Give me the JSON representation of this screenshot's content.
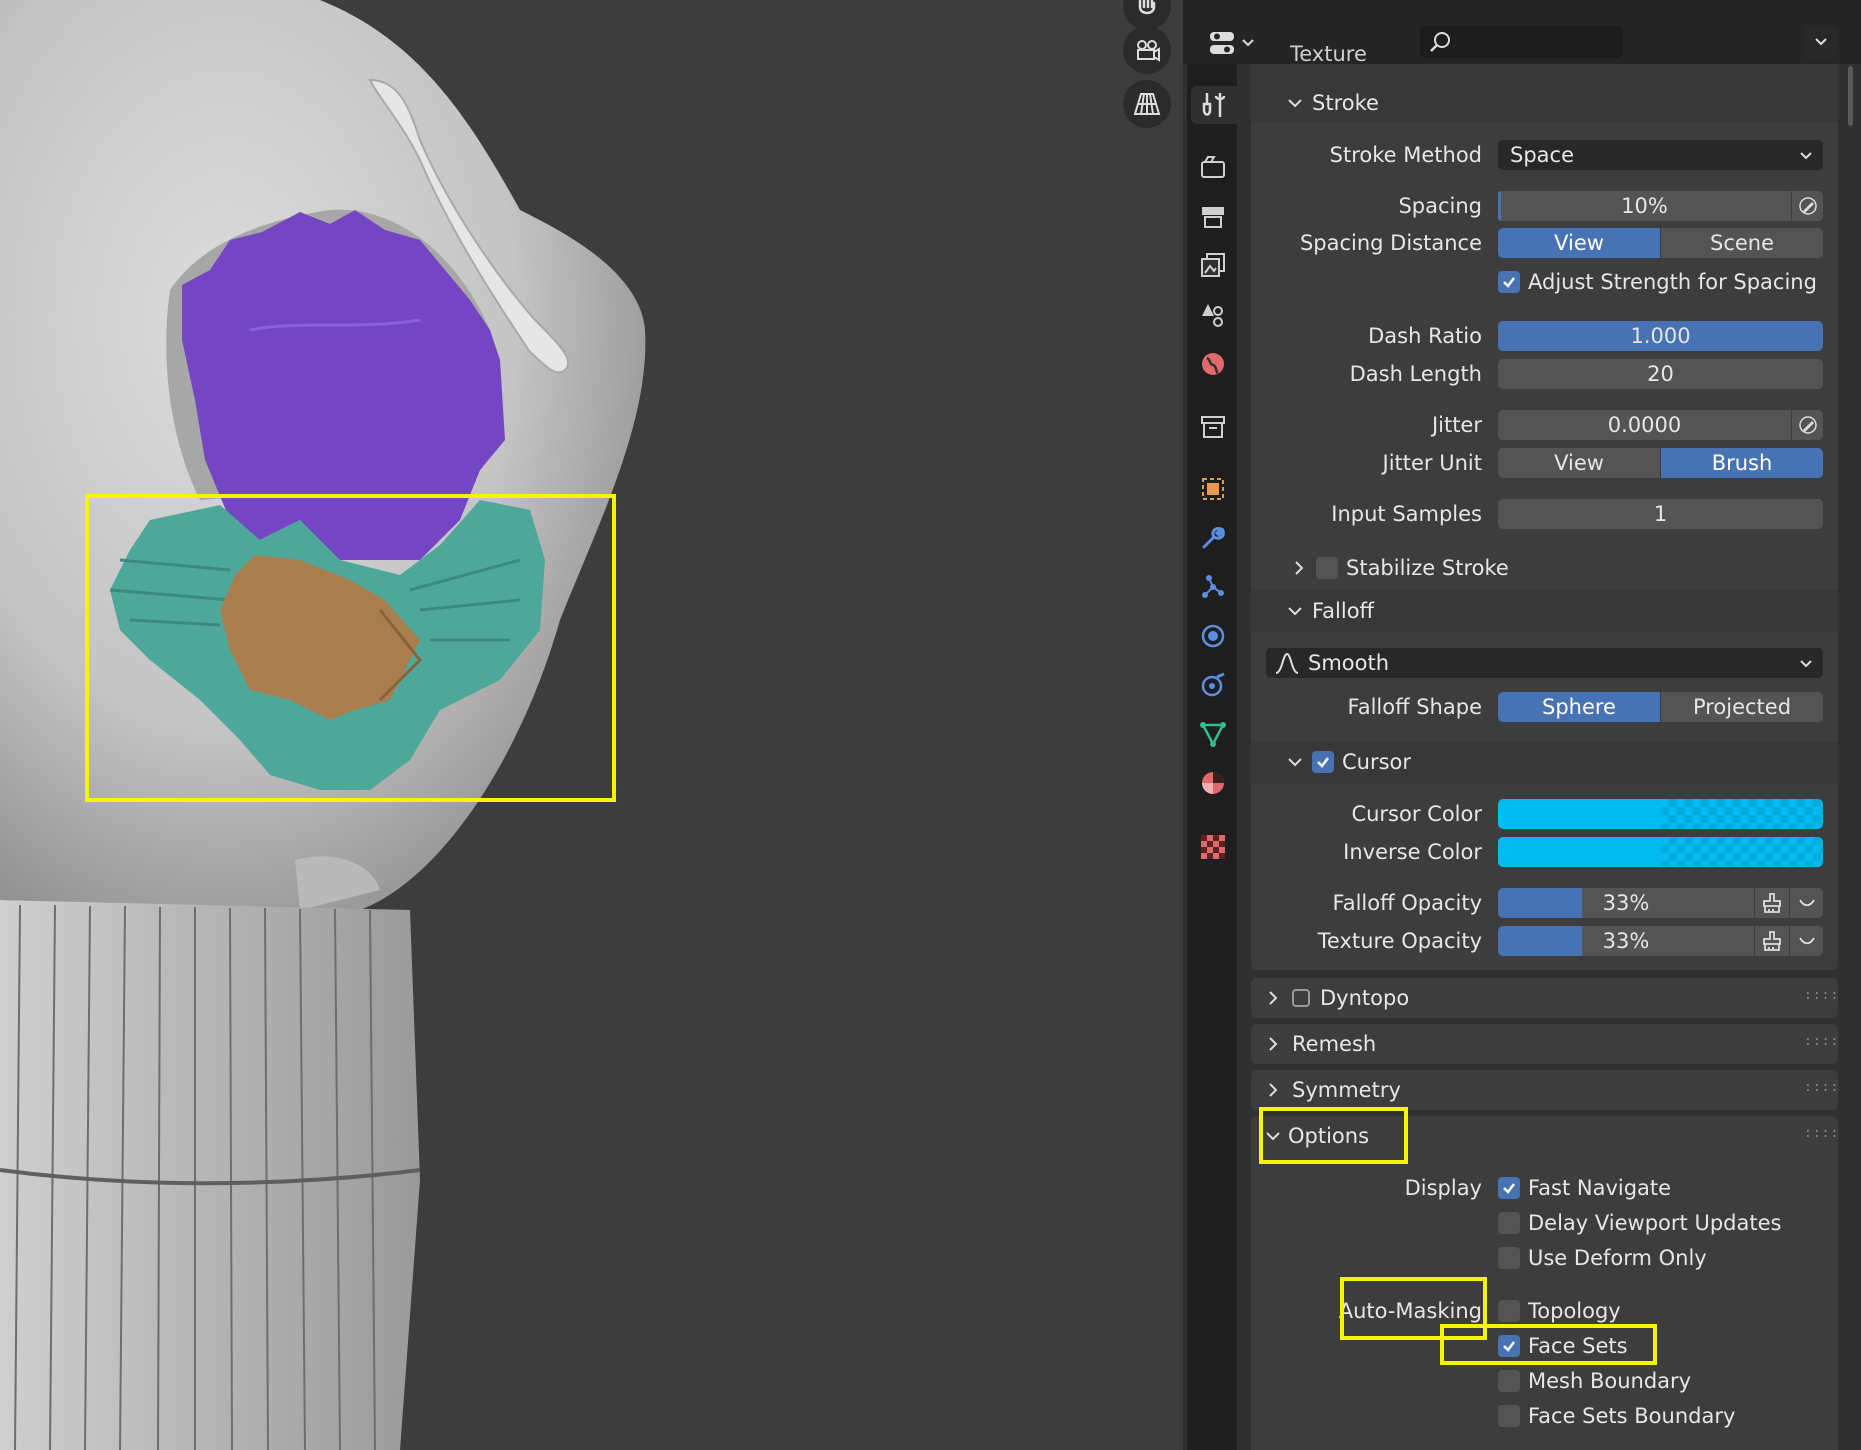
{
  "header": {
    "search_placeholder": "",
    "partial_panel": "Texture"
  },
  "tabs": [
    {
      "name": "tool-icon",
      "color": "#cfcfcf"
    },
    {
      "name": "render-icon",
      "color": "#cfcfcf"
    },
    {
      "name": "output-icon",
      "color": "#cfcfcf"
    },
    {
      "name": "view-layer-icon",
      "color": "#cfcfcf"
    },
    {
      "name": "scene-icon",
      "color": "#cfcfcf"
    },
    {
      "name": "world-icon",
      "color": "#e06a6a"
    },
    {
      "name": "collection-icon",
      "color": "#cfcfcf"
    },
    {
      "name": "object-icon",
      "color": "#e89a4c"
    },
    {
      "name": "modifier-icon",
      "color": "#5b8ee0"
    },
    {
      "name": "particles-icon",
      "color": "#5b8ee0"
    },
    {
      "name": "physics-icon",
      "color": "#5b8ee0"
    },
    {
      "name": "constraints-icon",
      "color": "#5b8ee0"
    },
    {
      "name": "data-icon",
      "color": "#2fbf8f"
    },
    {
      "name": "material-icon",
      "color": "#e06a6a"
    },
    {
      "name": "texture-icon",
      "color": "#e06a6a"
    }
  ],
  "stroke": {
    "title": "Stroke",
    "method_label": "Stroke Method",
    "method_value": "Space",
    "spacing_label": "Spacing",
    "spacing_value": "10%",
    "spacing_fill": 0.01,
    "spacing_distance_label": "Spacing Distance",
    "spacing_distance_options": [
      "View",
      "Scene"
    ],
    "adjust_strength_label": "Adjust Strength for Spacing",
    "dash_ratio_label": "Dash Ratio",
    "dash_ratio_value": "1.000",
    "dash_length_label": "Dash Length",
    "dash_length_value": "20",
    "jitter_label": "Jitter",
    "jitter_value": "0.0000",
    "jitter_unit_label": "Jitter Unit",
    "jitter_unit_options": [
      "View",
      "Brush"
    ],
    "input_samples_label": "Input Samples",
    "input_samples_value": "1",
    "stabilize_label": "Stabilize Stroke"
  },
  "falloff": {
    "title": "Falloff",
    "preset_value": "Smooth",
    "shape_label": "Falloff Shape",
    "shape_options": [
      "Sphere",
      "Projected"
    ]
  },
  "cursor": {
    "title": "Cursor",
    "cursor_color_label": "Cursor Color",
    "inverse_color_label": "Inverse Color",
    "cursor_color": "#00bbf0",
    "falloff_opacity_label": "Falloff Opacity",
    "falloff_opacity_value": "33%",
    "falloff_opacity_fill": 0.33,
    "texture_opacity_label": "Texture Opacity",
    "texture_opacity_value": "33%",
    "texture_opacity_fill": 0.33
  },
  "panels": {
    "dyntopo": "Dyntopo",
    "remesh": "Remesh",
    "symmetry": "Symmetry",
    "options": "Options"
  },
  "options": {
    "display_label": "Display",
    "fast_navigate": "Fast Navigate",
    "delay_viewport": "Delay Viewport Updates",
    "use_deform_only": "Use Deform Only",
    "automasking_label": "Auto-Masking",
    "topology": "Topology",
    "face_sets": "Face Sets",
    "mesh_boundary": "Mesh Boundary",
    "face_sets_boundary": "Face Sets Boundary"
  }
}
